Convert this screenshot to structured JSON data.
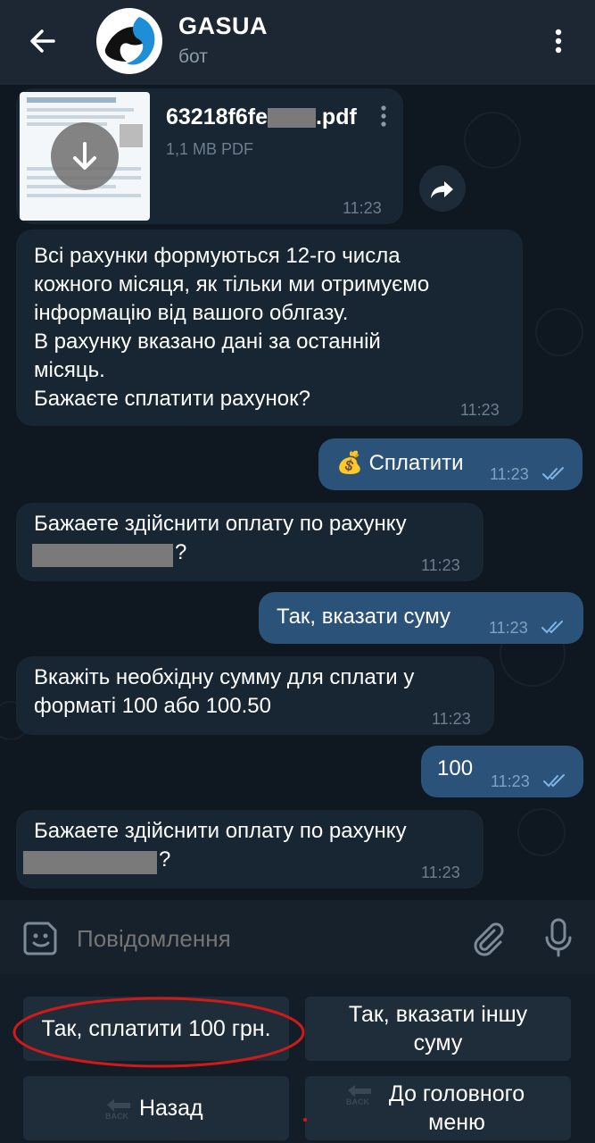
{
  "header": {
    "title": "GASUA",
    "subtitle": "бот"
  },
  "messages": {
    "file": {
      "filename": ".pdf",
      "filename_prefix": "63218f6fe",
      "meta": "1,1 MB PDF",
      "time": "11:23"
    },
    "m1": {
      "text": "Всі рахунки формуються 12-го числа\nкожного місяця, як тільки ми отримуємо\nінформацію від вашого облгазу.\nВ рахунку вказано дані за останній\nмісяць.\nБажаєте сплатити рахунок?",
      "time": "11:23"
    },
    "m2": {
      "emoji": "💰",
      "text": "Сплатити",
      "time": "11:23"
    },
    "m3": {
      "text": "Бажаете здійснити оплату по рахунку",
      "suffix": "?",
      "time": "11:23"
    },
    "m4": {
      "text": "Так, вказати суму",
      "time": "11:23"
    },
    "m5": {
      "text": "Вкажіть необхідну сумму для сплати у\nформаті 100 або 100.50",
      "time": "11:23"
    },
    "m6": {
      "text": "100",
      "time": "11:23"
    },
    "m7": {
      "text": "Бажаете здійснити оплату по рахунку",
      "suffix": "?",
      "time": "11:23"
    }
  },
  "composer": {
    "placeholder": "Повідомлення"
  },
  "keyboard": {
    "btn1": "Так, сплатити 100 грн.",
    "btn2": "Так, вказати іншу\nсуму",
    "btn3": "Назад",
    "btn4": "До головного\nменю",
    "back_icon_text": "BACK"
  },
  "colors": {
    "header_bg": "#1c2733",
    "incoming_bubble": "#182533",
    "outgoing_bubble": "#2b5278",
    "annotation_red": "#d01a1a"
  }
}
